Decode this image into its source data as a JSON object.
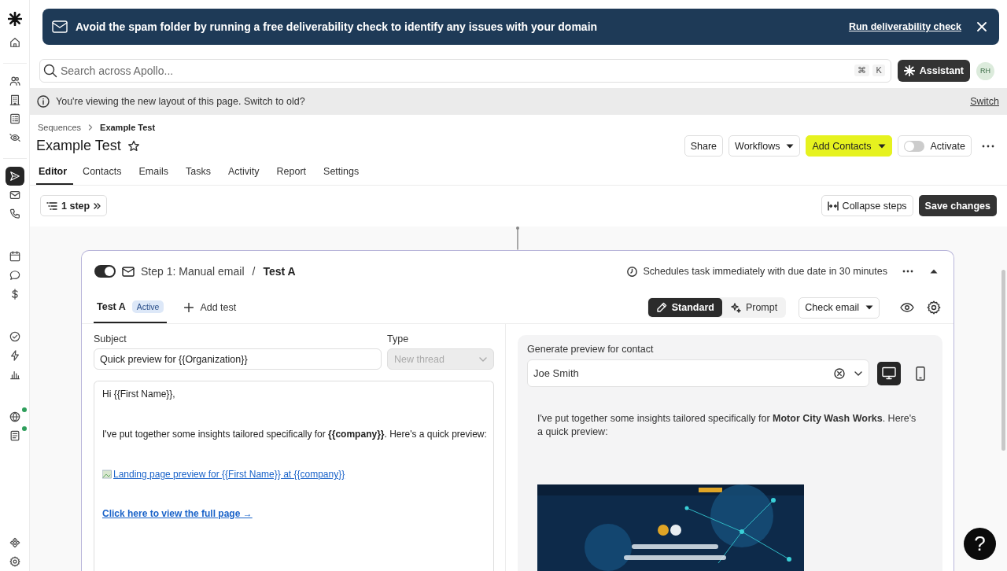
{
  "sidebar": {
    "items": [
      {
        "selected": false,
        "dot": false
      },
      {
        "selected": false,
        "dot": false
      },
      {
        "selected": false,
        "dot": false
      },
      {
        "selected": false,
        "dot": false
      },
      {
        "selected": false,
        "dot": false
      },
      {
        "selected": false,
        "dot": false
      },
      {
        "selected": true,
        "dot": false
      },
      {
        "selected": false,
        "dot": false
      },
      {
        "selected": false,
        "dot": false
      },
      {
        "selected": false,
        "dot": false
      },
      {
        "selected": false,
        "dot": false
      },
      {
        "selected": false,
        "dot": false
      },
      {
        "selected": false,
        "dot": false
      },
      {
        "selected": false,
        "dot": false
      },
      {
        "selected": false,
        "dot": false
      },
      {
        "selected": false,
        "dot": true
      },
      {
        "selected": false,
        "dot": true
      },
      {
        "selected": false,
        "dot": false
      },
      {
        "selected": false,
        "dot": false
      }
    ]
  },
  "banner": {
    "message": "Avoid the spam folder by running a free deliverability check to identify any issues with your domain",
    "link": "Run deliverability check"
  },
  "search": {
    "placeholder": "Search across Apollo...",
    "shortcut": [
      "⌘",
      "K"
    ]
  },
  "assistant_button": "Assistant",
  "avatar": "RH",
  "notice": {
    "text": "You're viewing the new layout of this page. Switch to old?",
    "link": "Switch"
  },
  "breadcrumbs": [
    "Sequences",
    "Example Test"
  ],
  "title": "Example Test",
  "starred": false,
  "header_buttons": [
    {
      "label": "Share",
      "kind": "plain"
    },
    {
      "label": "Workflows",
      "kind": "dropdown"
    },
    {
      "label": "Add Contacts",
      "kind": "primary"
    },
    {
      "label": "Activate",
      "kind": "toggle",
      "on": false
    }
  ],
  "tabs": [
    {
      "label": "Editor",
      "selected": true
    },
    {
      "label": "Contacts",
      "selected": false
    },
    {
      "label": "Emails",
      "selected": false
    },
    {
      "label": "Tasks",
      "selected": false
    },
    {
      "label": "Activity",
      "selected": false
    },
    {
      "label": "Report",
      "selected": false
    },
    {
      "label": "Settings",
      "selected": false
    }
  ],
  "steps_button": "1 step",
  "collapse_button": "Collapse steps",
  "save_button": "Save changes",
  "step": {
    "enabled": true,
    "title": "Step 1: Manual email",
    "separator": "/",
    "variant": "Test A",
    "schedule": "Schedules task immediately with due date in 30 minutes",
    "expanded": true,
    "tests": [
      {
        "label": "Test A",
        "badge": "Active",
        "selected": true
      }
    ],
    "add_test": "Add test",
    "modes": [
      {
        "label": "Standard",
        "selected": true
      },
      {
        "label": "Prompt",
        "selected": false
      }
    ],
    "check_email": "Check email",
    "subject": {
      "label": "Subject",
      "value": "Quick preview for {{Organization}}"
    },
    "type": {
      "label": "Type",
      "value": "New thread",
      "disabled": true
    },
    "body": [
      {
        "kind": "text",
        "text": "Hi {{First Name}},"
      },
      {
        "kind": "text",
        "text": "I've put together some insights tailored specifically for **{{company}}**. Here's a quick preview:"
      },
      {
        "kind": "image_link",
        "text": "Landing page preview for {{First Name}} at {{company}}"
      },
      {
        "kind": "link",
        "text": "Click here to view the full page →"
      }
    ],
    "preview": {
      "label": "Generate preview for contact",
      "contact": "Joe Smith",
      "devices": [
        {
          "selected": true
        },
        {
          "selected": false
        }
      ],
      "body": [
        {
          "kind": "text",
          "text": "I've put together some insights tailored specifically for **Motor City Wash Works**. Here's a quick preview:"
        },
        {
          "kind": "picture"
        }
      ]
    }
  },
  "help_button": "?"
}
